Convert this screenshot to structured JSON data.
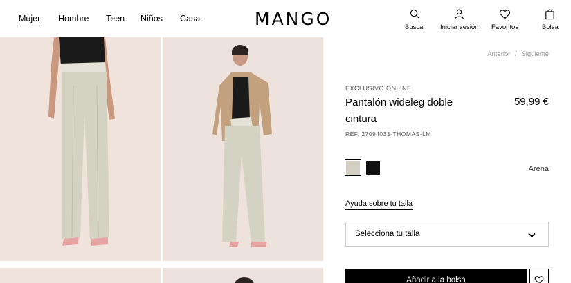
{
  "header": {
    "nav": [
      {
        "label": "Mujer",
        "active": true
      },
      {
        "label": "Hombre",
        "active": false
      },
      {
        "label": "Teen",
        "active": false
      },
      {
        "label": "Niños",
        "active": false
      },
      {
        "label": "Casa",
        "active": false
      }
    ],
    "logo": "MANGO",
    "tools": [
      {
        "label": "Buscar",
        "icon": "search-icon"
      },
      {
        "label": "Iniciar sesión",
        "icon": "user-icon"
      },
      {
        "label": "Favoritos",
        "icon": "heart-icon"
      },
      {
        "label": "Bolsa",
        "icon": "bag-icon"
      }
    ]
  },
  "breadcrumbs": {
    "prev": "Anterior",
    "sep": "/",
    "next": "Siguiente"
  },
  "product": {
    "eyebrow": "EXCLUSIVO ONLINE",
    "title": "Pantalón wideleg doble cintura",
    "price": "59,99 €",
    "ref": "REF. 27094033-THOMAS-LM",
    "colors": [
      {
        "name": "Arena",
        "hex": "#d3cfc2",
        "selected": true
      },
      {
        "name": "Negro",
        "hex": "#111111",
        "selected": false
      }
    ],
    "selected_color": "Arena",
    "size_help": "Ayuda sobre tu talla",
    "size_select": "Selecciona tu talla",
    "add_to_bag": "Añadir a la bolsa"
  },
  "colors": {
    "background": "#ffffff",
    "photo_bg": "#efe3dc",
    "button": "#000000",
    "text_muted": "#999999"
  }
}
